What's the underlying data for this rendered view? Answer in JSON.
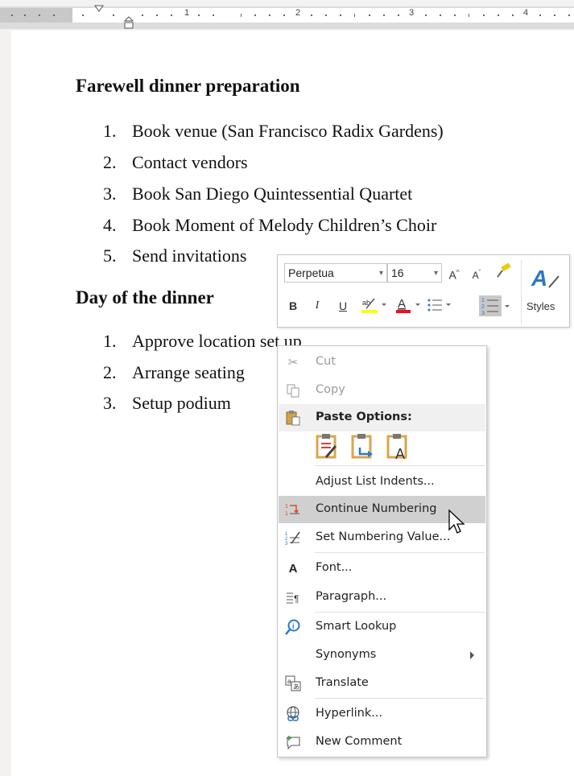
{
  "ruler": {
    "numbers": [
      "1",
      "2",
      "3",
      "4"
    ]
  },
  "document": {
    "heading1": "Farewell dinner preparation",
    "list1": [
      {
        "num": "1.",
        "text": "Book venue (San Francisco Radix Gardens)"
      },
      {
        "num": "2.",
        "text": "Contact vendors"
      },
      {
        "num": "3.",
        "text": "Book San Diego Quintessential Quartet"
      },
      {
        "num": "4.",
        "text": "Book Moment of Melody Children’s Choir"
      },
      {
        "num": "5.",
        "text": "Send invitations"
      }
    ],
    "heading2": "Day of the dinner",
    "list2": [
      {
        "num": "1.",
        "text": "Approve location set up"
      },
      {
        "num": "2.",
        "text": "Arrange seating"
      },
      {
        "num": "3.",
        "text": "Setup podium"
      }
    ]
  },
  "mini_toolbar": {
    "font": "Perpetua",
    "size": "16",
    "grow_font": "A",
    "shrink_font": "A",
    "bold": "B",
    "italic": "I",
    "underline": "U",
    "font_color": "A",
    "styles_label": "Styles",
    "icons": [
      "format-painter-icon",
      "highlight-icon",
      "bullets-icon",
      "numbering-icon",
      "styles-icon"
    ]
  },
  "context_menu": {
    "cut": "Cut",
    "copy": "Copy",
    "paste_options": "Paste Options:",
    "adjust_list_indents": "Adjust List Indents...",
    "continue_numbering": "Continue Numbering",
    "set_numbering_value": "Set Numbering Value...",
    "font": "Font...",
    "font_icon": "A",
    "paragraph": "Paragraph...",
    "smart_lookup": "Smart Lookup",
    "synonyms": "Synonyms",
    "translate": "Translate",
    "hyperlink": "Hyperlink...",
    "new_comment": "New Comment"
  },
  "colors": {
    "accent_blue": "#2b79c6",
    "highlight_yellow": "#ffff00",
    "font_red": "#e81123",
    "menu_highlight": "#d0d0d0"
  }
}
